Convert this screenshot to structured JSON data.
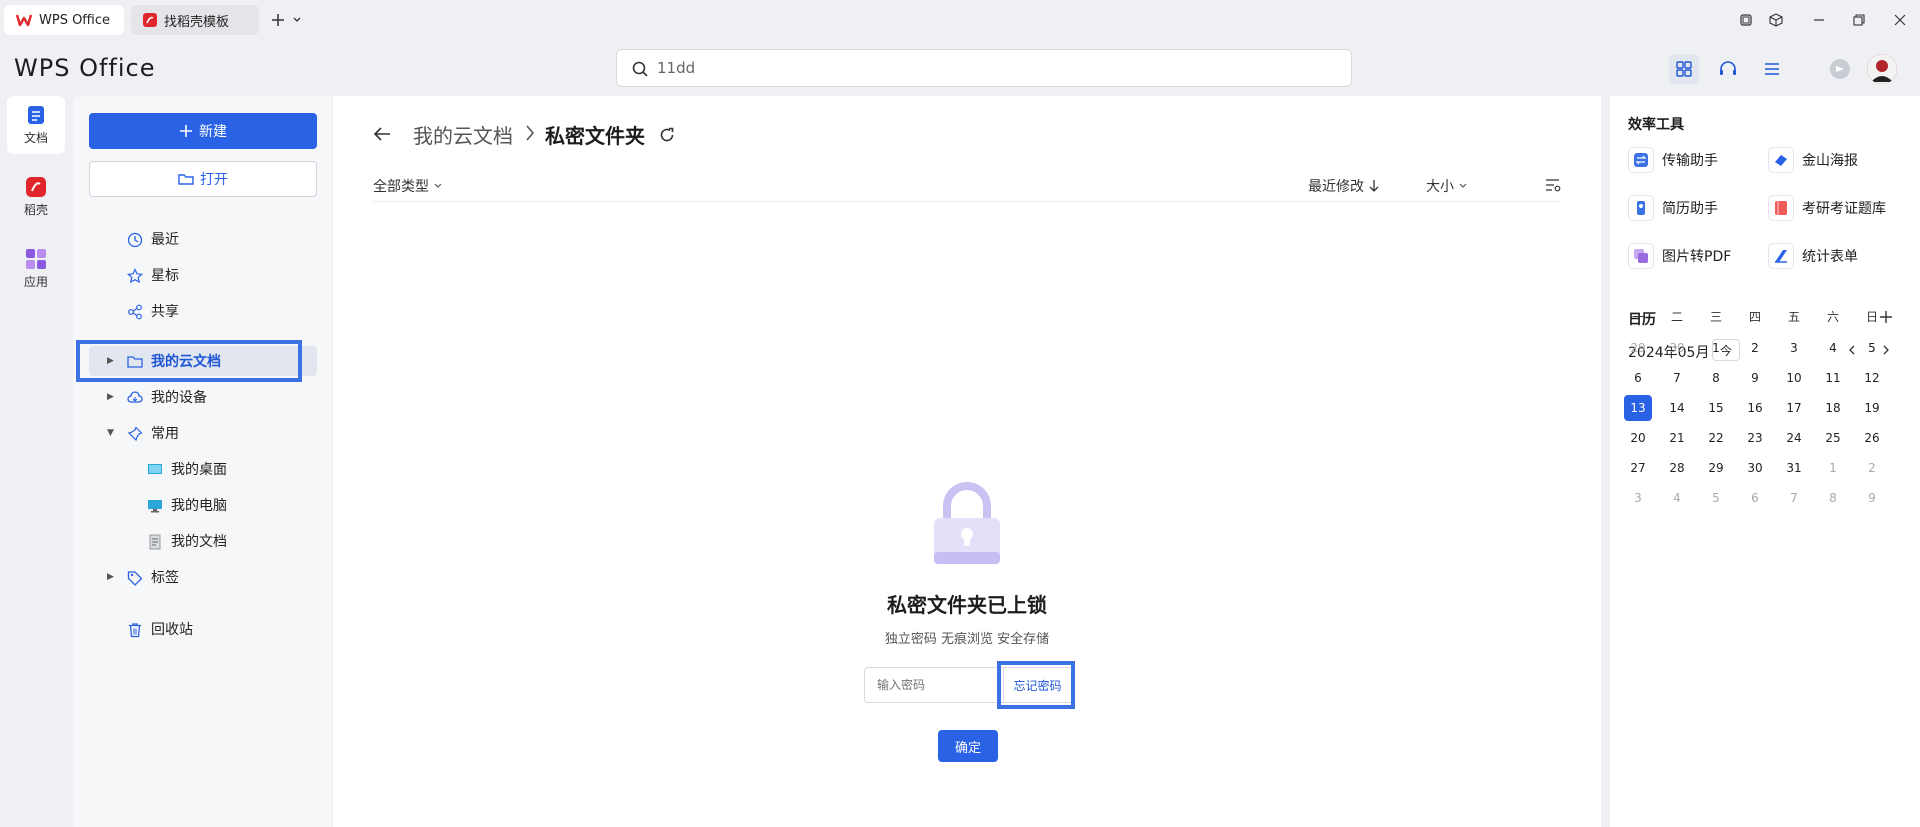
{
  "tabs": [
    {
      "label": "WPS Office"
    },
    {
      "label": "找稻壳模板"
    }
  ],
  "header": {
    "logo": "WPS Office",
    "search_value": "11dd"
  },
  "rail": [
    {
      "label": "文档"
    },
    {
      "label": "稻壳"
    },
    {
      "label": "应用"
    }
  ],
  "sidebar": {
    "new_label": "新建",
    "open_label": "打开",
    "items": [
      {
        "label": "最近"
      },
      {
        "label": "星标"
      },
      {
        "label": "共享"
      },
      {
        "label": "我的云文档"
      },
      {
        "label": "我的设备"
      },
      {
        "label": "常用"
      },
      {
        "label": "我的桌面"
      },
      {
        "label": "我的电脑"
      },
      {
        "label": "我的文档"
      },
      {
        "label": "标签"
      },
      {
        "label": "回收站"
      }
    ]
  },
  "main": {
    "breadcrumb": [
      "我的云文档",
      "私密文件夹"
    ],
    "filter_type": "全部类型",
    "sort_label": "最近修改",
    "size_label": "大小",
    "locked_title": "私密文件夹已上锁",
    "locked_sub": "独立密码 无痕浏览 安全存储",
    "password_placeholder": "输入密码",
    "forgot_label": "忘记密码",
    "confirm_label": "确定"
  },
  "tools": {
    "title": "效率工具",
    "items": [
      {
        "label": "传输助手",
        "icon": "transfer-icon",
        "color": "#3b73e5"
      },
      {
        "label": "金山海报",
        "icon": "poster-icon",
        "color": "#2a62e6"
      },
      {
        "label": "简历助手",
        "icon": "resume-icon",
        "color": "#3b73e5"
      },
      {
        "label": "考研考证题库",
        "icon": "exam-icon",
        "color": "#f05a5a"
      },
      {
        "label": "图片转PDF",
        "icon": "image-pdf-icon",
        "color": "#9b6be0"
      },
      {
        "label": "统计表单",
        "icon": "form-icon",
        "color": "#2a62e6"
      }
    ]
  },
  "calendar": {
    "title": "日历",
    "month": "2024年05月",
    "today_label": "今",
    "weekdays": [
      "一",
      "二",
      "三",
      "四",
      "五",
      "六",
      "日"
    ],
    "days": [
      [
        "29",
        "30",
        "1",
        "2",
        "3",
        "4",
        "5"
      ],
      [
        "6",
        "7",
        "8",
        "9",
        "10",
        "11",
        "12"
      ],
      [
        "13",
        "14",
        "15",
        "16",
        "17",
        "18",
        "19"
      ],
      [
        "20",
        "21",
        "22",
        "23",
        "24",
        "25",
        "26"
      ],
      [
        "27",
        "28",
        "29",
        "30",
        "31",
        "1",
        "2"
      ],
      [
        "3",
        "4",
        "5",
        "6",
        "7",
        "8",
        "9"
      ]
    ],
    "selected": "13",
    "accent": "#2a62e6"
  }
}
